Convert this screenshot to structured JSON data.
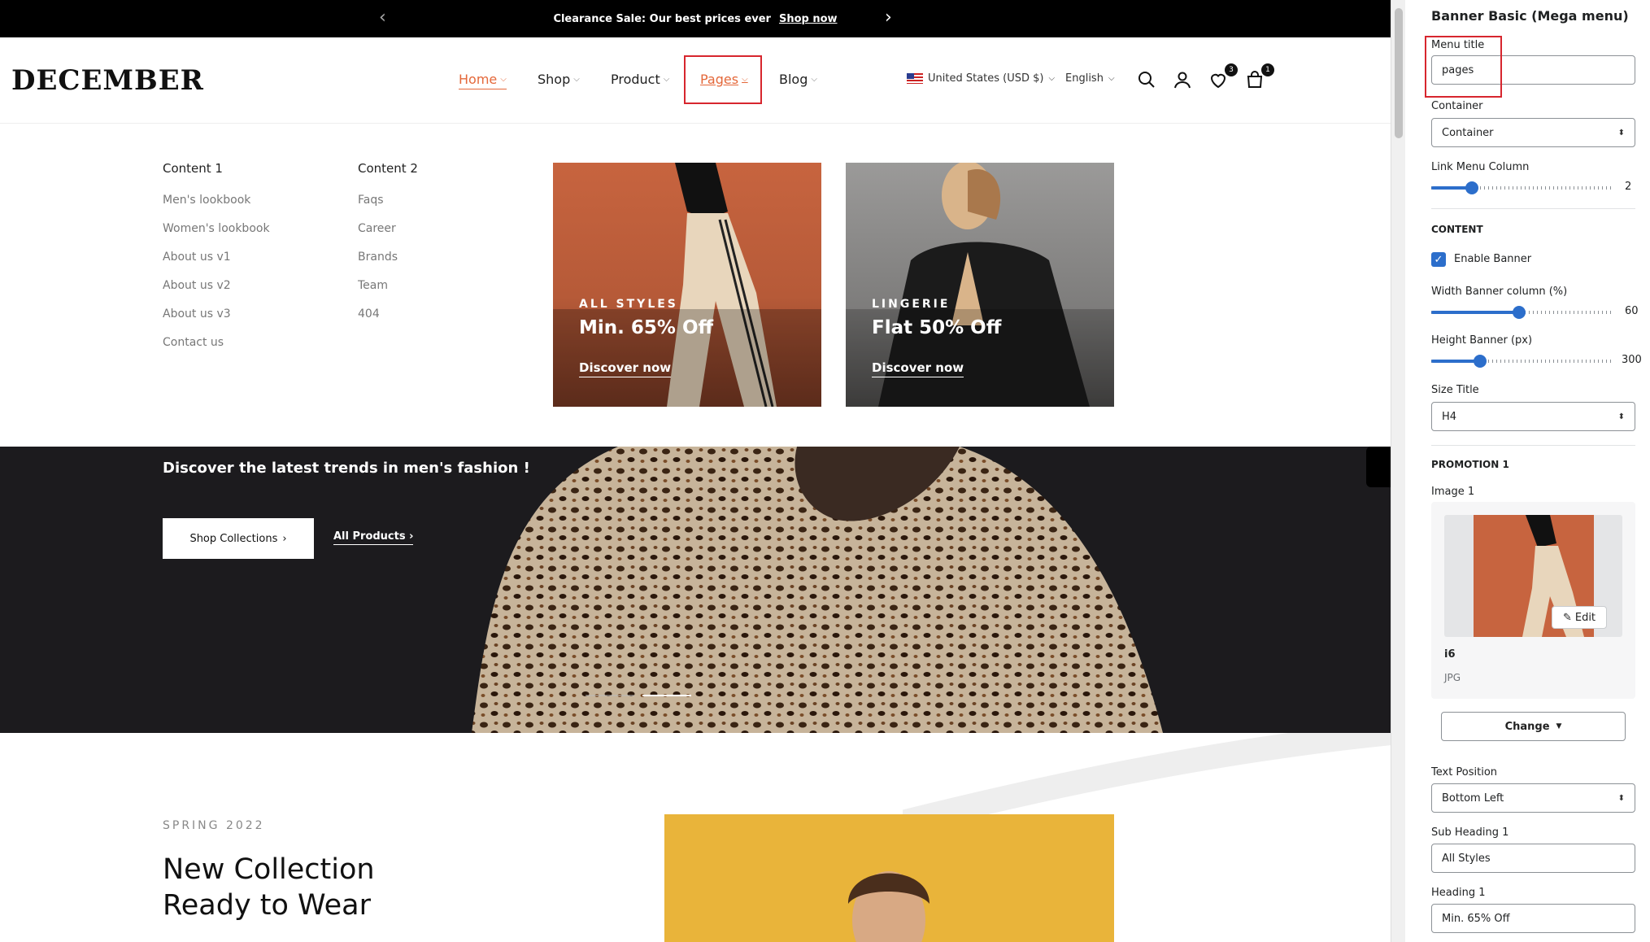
{
  "announcement": {
    "message": "Clearance Sale: Our best prices ever",
    "link": "Shop now"
  },
  "header": {
    "logo": "DECEMBER",
    "nav": [
      {
        "label": "Home"
      },
      {
        "label": "Shop"
      },
      {
        "label": "Product"
      },
      {
        "label": "Pages"
      },
      {
        "label": "Blog"
      }
    ],
    "currency": "United States (USD $)",
    "language": "English",
    "wishlist_count": "3",
    "cart_count": "1"
  },
  "mega_menu": {
    "column1": {
      "title": "Content 1",
      "links": [
        "Men's lookbook",
        "Women's lookbook",
        "About us v1",
        "About us v2",
        "About us v3",
        "Contact us"
      ]
    },
    "column2": {
      "title": "Content 2",
      "links": [
        "Faqs",
        "Career",
        "Brands",
        "Team",
        "404"
      ]
    },
    "banners": [
      {
        "sub": "ALL STYLES",
        "heading": "Min. 65% Off",
        "cta": "Discover now"
      },
      {
        "sub": "LINGERIE",
        "heading": "Flat 50% Off",
        "cta": "Discover now"
      }
    ]
  },
  "hero": {
    "tagline": "Discover the latest trends in men's fashion !",
    "primary_button": "Shop Collections",
    "secondary_button": "All Products"
  },
  "collection": {
    "season": "SPRING 2022",
    "title_line1": "New Collection",
    "title_line2": "Ready to Wear"
  },
  "panel": {
    "title": "Banner Basic (Mega menu)",
    "menu_title_label": "Menu title",
    "menu_title_value": "pages",
    "container_label": "Container",
    "container_value": "Container",
    "link_menu_column_label": "Link Menu Column",
    "link_menu_column_value": "2",
    "content_section": "CONTENT",
    "enable_banner_label": "Enable Banner",
    "width_banner_label": "Width Banner column (%)",
    "width_banner_value": "60",
    "height_banner_label": "Height Banner (px)",
    "height_banner_value": "300",
    "size_title_label": "Size Title",
    "size_title_value": "H4",
    "promotion_section": "PROMOTION 1",
    "image_label": "Image 1",
    "image_name": "i6",
    "image_type": "JPG",
    "edit_label": "Edit",
    "change_label": "Change",
    "text_position_label": "Text Position",
    "text_position_value": "Bottom Left",
    "sub_heading_label": "Sub Heading 1",
    "sub_heading_value": "All Styles",
    "heading_label": "Heading 1",
    "heading_value": "Min. 65% Off"
  },
  "colors": {
    "accent": "#e4683a",
    "highlight_box": "#d7262e",
    "control_blue": "#2c6ecb"
  }
}
